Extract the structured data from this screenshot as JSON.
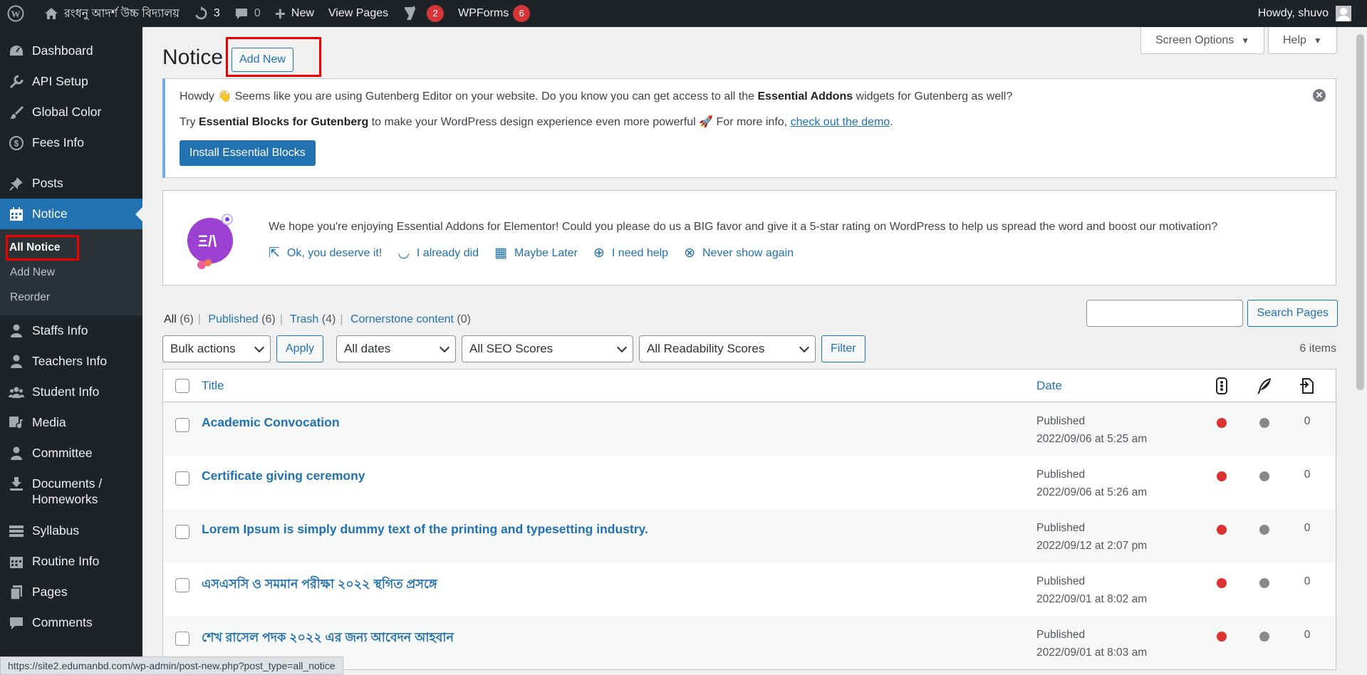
{
  "adminbar": {
    "site_name": "রংধনু আদর্শ উচ্চ বিদ্যালয়",
    "updates_count": "3",
    "comments_count": "0",
    "new_label": "New",
    "view_pages_label": "View Pages",
    "yoast_count": "2",
    "wpforms_label": "WPForms",
    "wpforms_count": "6",
    "howdy": "Howdy, shuvo"
  },
  "sidebar": {
    "items": [
      {
        "label": "Dashboard",
        "icon": "dashboard-icon"
      },
      {
        "label": "API Setup",
        "icon": "tools-icon"
      },
      {
        "label": "Global Color",
        "icon": "brush-icon"
      },
      {
        "label": "Fees Info",
        "icon": "dollar-icon"
      },
      {
        "label": "Posts",
        "icon": "pin-icon"
      },
      {
        "label": "Notice",
        "icon": "calendar-icon"
      },
      {
        "label": "Staffs Info",
        "icon": "user-icon"
      },
      {
        "label": "Teachers Info",
        "icon": "user-icon"
      },
      {
        "label": "Student Info",
        "icon": "groups-icon"
      },
      {
        "label": "Media",
        "icon": "media-icon"
      },
      {
        "label": "Committee",
        "icon": "user-icon"
      },
      {
        "label": "Documents / Homeworks",
        "icon": "download-icon"
      },
      {
        "label": "Syllabus",
        "icon": "list-icon"
      },
      {
        "label": "Routine Info",
        "icon": "calendar-icon"
      },
      {
        "label": "Pages",
        "icon": "pages-icon"
      },
      {
        "label": "Comments",
        "icon": "comment-icon"
      }
    ],
    "submenu": [
      "All Notice",
      "Add New",
      "Reorder"
    ]
  },
  "screen_options_label": "Screen Options",
  "help_label": "Help",
  "page": {
    "title": "Notice",
    "add_new": "Add New"
  },
  "notice_gutenberg": {
    "line1_a": "Howdy 👋 Seems like you are using Gutenberg Editor on your website. Do you know you can get access to all the ",
    "line1_b": "Essential Addons",
    "line1_c": " widgets for Gutenberg as well?",
    "line2_a": "Try ",
    "line2_b": "Essential Blocks for Gutenberg",
    "line2_c": " to make your WordPress design experience even more powerful 🚀 For more info, ",
    "line2_link": "check out the demo",
    "line2_d": ".",
    "button": "Install Essential Blocks"
  },
  "notice_ea": {
    "text": "We hope you're enjoying Essential Addons for Elementor! Could you please do us a BIG favor and give it a 5-star rating on WordPress to help us spread the word and boost our motivation?",
    "links": [
      "Ok, you deserve it!",
      "I already did",
      "Maybe Later",
      "I need help",
      "Never show again"
    ]
  },
  "views": {
    "all": "All",
    "all_count": "(6)",
    "published": "Published",
    "published_count": "(6)",
    "trash": "Trash",
    "trash_count": "(4)",
    "cornerstone": "Cornerstone content",
    "cornerstone_count": "(0)"
  },
  "search_button": "Search Pages",
  "tablenav": {
    "bulk": "Bulk actions",
    "apply": "Apply",
    "dates": "All dates",
    "seo": "All SEO Scores",
    "readability": "All Readability Scores",
    "filter": "Filter",
    "items": "6 items"
  },
  "table": {
    "headers": {
      "title": "Title",
      "date": "Date"
    },
    "rows": [
      {
        "title": "Academic Convocation",
        "status": "Published",
        "date": "2022/09/06 at 5:25 am",
        "links": "0"
      },
      {
        "title": "Certificate giving ceremony",
        "status": "Published",
        "date": "2022/09/06 at 5:26 am",
        "links": "0"
      },
      {
        "title": "Lorem Ipsum is simply dummy text of the printing and typesetting industry.",
        "status": "Published",
        "date": "2022/09/12 at 2:07 pm",
        "links": "0"
      },
      {
        "title": "এসএসসি ও সমমান পরীক্ষা ২০২২ স্থগিত প্রসঙ্গে",
        "status": "Published",
        "date": "2022/09/01 at 8:02 am",
        "links": "0"
      },
      {
        "title": "শেখ রাসেল পদক ২০২২ এর জন্য আবেদন আহবান",
        "status": "Published",
        "date": "2022/09/01 at 8:03 am",
        "links": "0"
      }
    ]
  },
  "status_url": "https://site2.edumanbd.com/wp-admin/post-new.php?post_type=all_notice",
  "colors": {
    "accent": "#2271b1",
    "admin_dark": "#1d2327",
    "highlight": "#ee0000",
    "seo_bad": "#dc3232",
    "readability_na": "#888888"
  }
}
